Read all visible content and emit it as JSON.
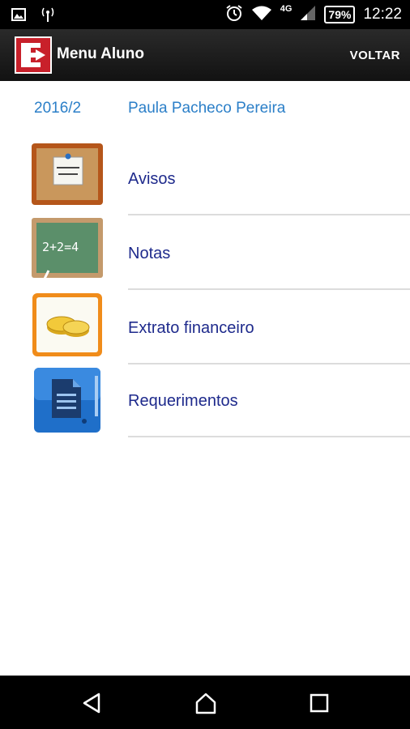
{
  "status_bar": {
    "network_label": "4G",
    "battery": "79%",
    "time": "12:22",
    "icons": [
      "image-icon",
      "radio-antenna-icon",
      "alarm-icon",
      "wifi-icon",
      "signal-icon",
      "battery-icon"
    ]
  },
  "action_bar": {
    "title": "Menu Aluno",
    "back_label": "VOLTAR"
  },
  "header": {
    "semester": "2016/2",
    "student_name": "Paula Pacheco Pereira"
  },
  "menu": {
    "items": [
      {
        "label": "Avisos",
        "icon": "notice-board-icon"
      },
      {
        "label": "Notas",
        "icon": "chalkboard-icon"
      },
      {
        "label": "Extrato financeiro",
        "icon": "coins-icon"
      },
      {
        "label": "Requerimentos",
        "icon": "document-icon"
      }
    ]
  },
  "navigation": {
    "buttons": [
      "back-triangle-icon",
      "home-icon",
      "recents-square-icon"
    ]
  },
  "colors": {
    "status_bar": "#000000",
    "action_bar": "#1c1c1c",
    "accent_blue": "#2b7fc8",
    "menu_text": "#1e2a8c",
    "divider": "#dcdcdc"
  }
}
